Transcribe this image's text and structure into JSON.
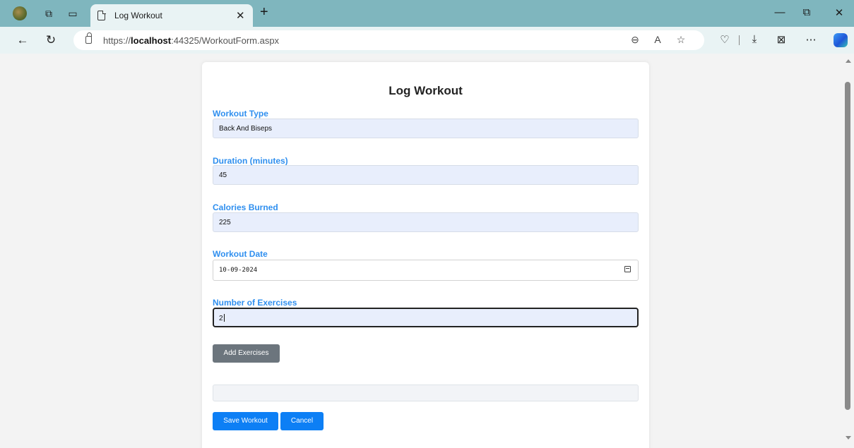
{
  "browser": {
    "tab_title": "Log Workout",
    "url_prefix": "https://",
    "url_host": "localhost",
    "url_rest": ":44325/WorkoutForm.aspx"
  },
  "form": {
    "title": "Log Workout",
    "fields": [
      {
        "label": "Workout Type",
        "value": "Back And Biseps"
      },
      {
        "label": "Duration (minutes)",
        "value": "45"
      },
      {
        "label": "Calories Burned",
        "value": "225"
      },
      {
        "label": "Workout Date",
        "value": "10-09-2024"
      },
      {
        "label": "Number of Exercises",
        "value": "2"
      }
    ],
    "add_exercises_label": "Add Exercises",
    "save_label": "Save Workout",
    "cancel_label": "Cancel"
  },
  "colors": {
    "label_blue": "#2f8fef",
    "primary_button": "#0d7ff5",
    "secondary_button": "#6c757d",
    "title_bar": "#7fb6be"
  }
}
